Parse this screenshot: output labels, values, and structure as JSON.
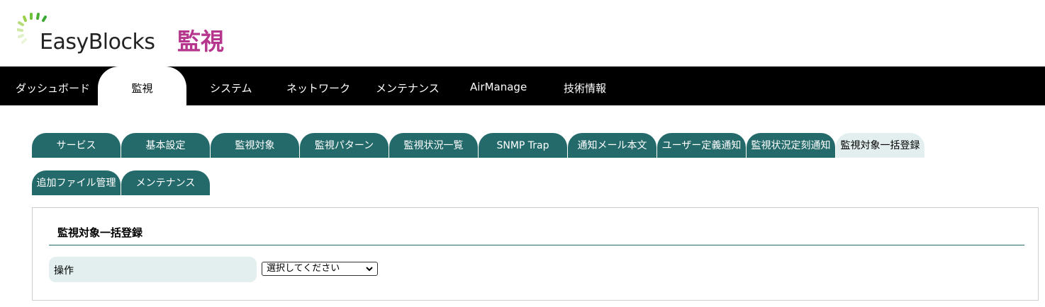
{
  "header": {
    "logo_text": "EasyBlocks",
    "title": "監視"
  },
  "mainnav": {
    "items": [
      {
        "label": "ダッシュボード",
        "active": false
      },
      {
        "label": "監視",
        "active": true
      },
      {
        "label": "システム",
        "active": false
      },
      {
        "label": "ネットワーク",
        "active": false
      },
      {
        "label": "メンテナンス",
        "active": false
      },
      {
        "label": "AirManage",
        "active": false
      },
      {
        "label": "技術情報",
        "active": false
      }
    ]
  },
  "subtabs": {
    "row1": [
      {
        "label": "サービス",
        "active": false
      },
      {
        "label": "基本設定",
        "active": false
      },
      {
        "label": "監視対象",
        "active": false
      },
      {
        "label": "監視パターン",
        "active": false
      },
      {
        "label": "監視状況一覧",
        "active": false
      },
      {
        "label": "SNMP Trap",
        "active": false
      },
      {
        "label": "通知メール本文",
        "active": false
      },
      {
        "label": "ユーザー定義通知",
        "active": false
      },
      {
        "label": "監視状況定刻通知",
        "active": false
      },
      {
        "label": "監視対象一括登録",
        "active": true
      }
    ],
    "row2": [
      {
        "label": "追加ファイル管理",
        "active": false
      },
      {
        "label": "メンテナンス",
        "active": false
      }
    ]
  },
  "panel": {
    "title": "監視対象一括登録",
    "field": {
      "label": "操作",
      "select_value": "選択してください"
    }
  },
  "colors": {
    "brand_title": "#b5368c",
    "tab_bg": "#256a6b",
    "tab_active_bg": "#e2efee",
    "nav_bg": "#000000"
  }
}
